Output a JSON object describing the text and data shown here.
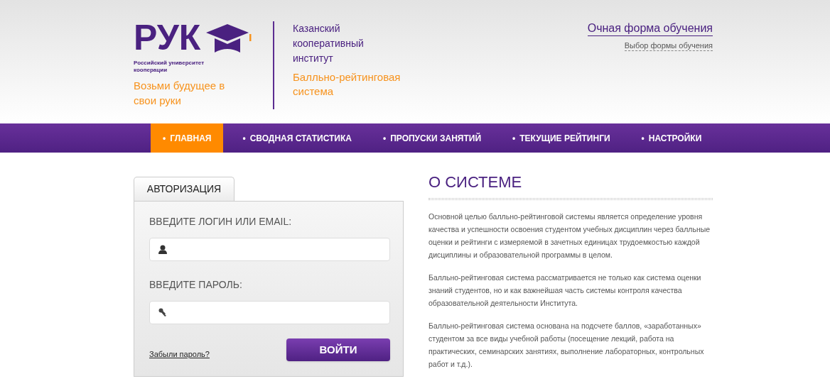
{
  "header": {
    "logo": {
      "wordmark": "РУК",
      "subtitle": "Российский университет кооперации",
      "slogan": "Возьми будущее в свои руки"
    },
    "institute": {
      "name": "Казанский кооперативный институт",
      "system": "Балльно-рейтинговая система"
    },
    "study_form": {
      "current": "Очная форма обучения",
      "link": "Выбор формы обучения"
    }
  },
  "nav": [
    {
      "marker": "•",
      "label": "ГЛАВНАЯ",
      "selected": true
    },
    {
      "marker": "•",
      "label": "СВОДНАЯ СТАТИСТИКА",
      "selected": false
    },
    {
      "marker": "•",
      "label": "ПРОПУСКИ ЗАНЯТИЙ",
      "selected": false
    },
    {
      "marker": "•",
      "label": "ТЕКУЩИЕ РЕЙТИНГИ",
      "selected": false
    },
    {
      "marker": "•",
      "label": "НАСТРОЙКИ",
      "selected": false
    }
  ],
  "login": {
    "tab": "АВТОРИЗАЦИЯ",
    "login_label": "ВВЕДИТЕ ЛОГИН ИЛИ EMAIL:",
    "password_label": "ВВЕДИТЕ ПАРОЛЬ:",
    "forgot": "Забыли пароль?",
    "submit": "ВОЙТИ"
  },
  "about": {
    "title": "О СИСТЕМЕ",
    "paragraphs": [
      "Основной целью балльно-рейтинговой системы является определение уровня качества и успешности освоения студентом учебных дисциплин через балльные оценки и рейтинги с измеряемой в зачетных единицах трудоемкостью каждой дисциплины и образовательной программы в целом.",
      "Балльно-рейтинговая система рассматривается не только как система оценки знаний студентов, но и как важнейшая часть системы контроля качества образовательной деятельности Института.",
      "Балльно-рейтинговая система основана на подсчете баллов, «заработанных» студентом за все виды учебной работы (посещение лекций, работа на практических, семинарских занятиях, выполнение лабораторных, контрольных работ и т.д.)."
    ]
  }
}
